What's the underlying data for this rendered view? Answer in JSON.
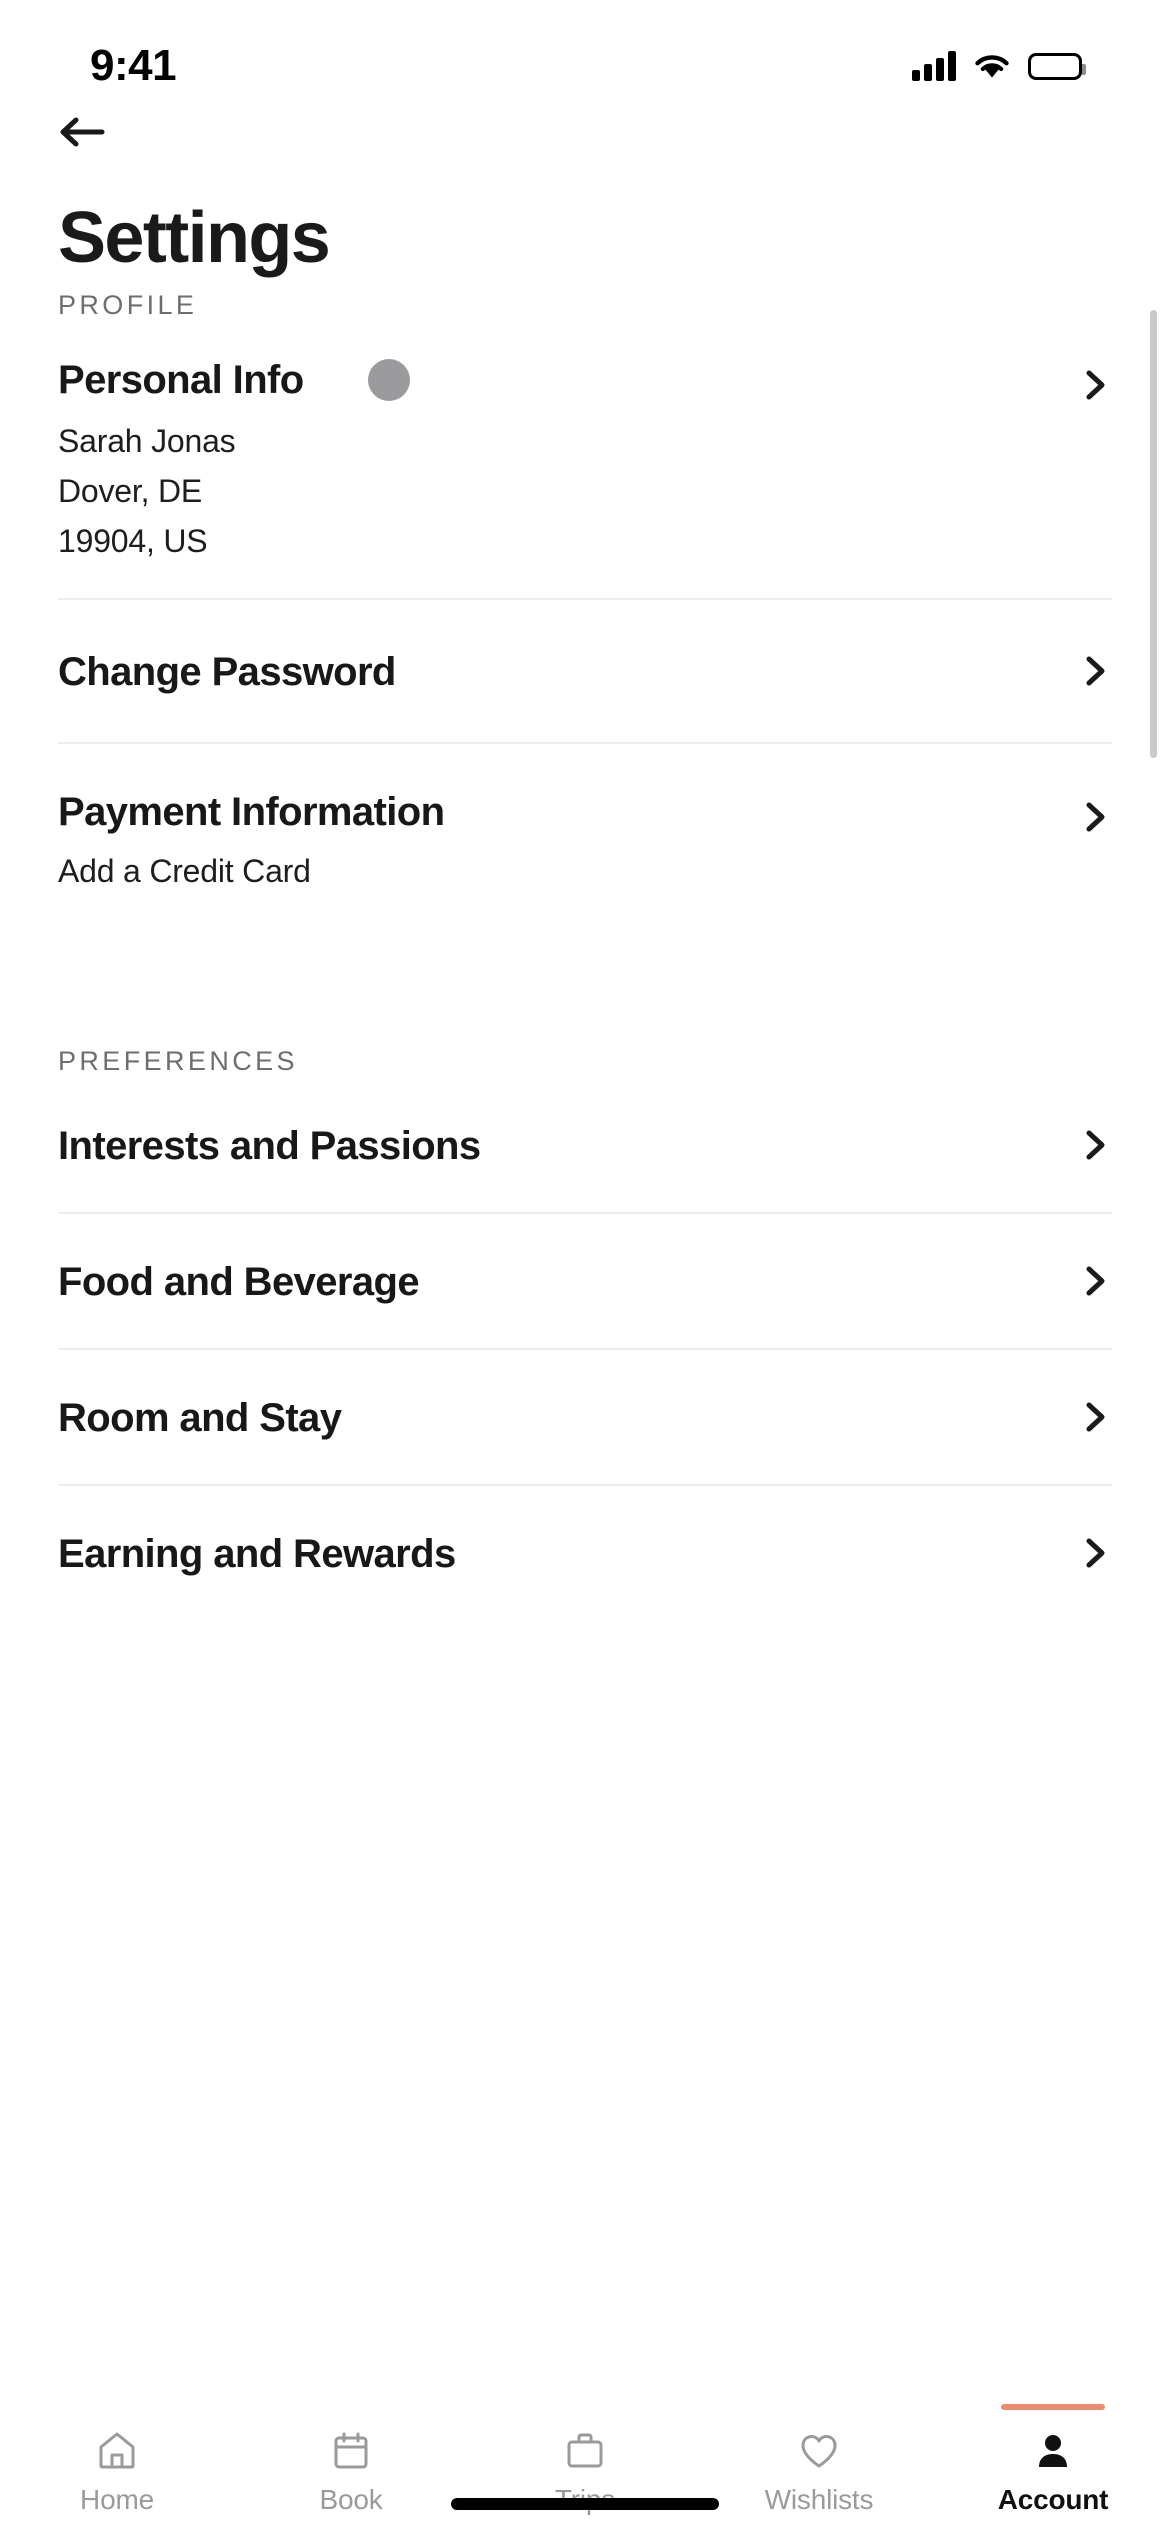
{
  "status_bar": {
    "time": "9:41",
    "cellular_icon": "cellular-signal-icon",
    "wifi_icon": "wifi-icon",
    "battery_icon": "battery-full-icon"
  },
  "nav": {
    "back_icon": "back-arrow-icon"
  },
  "header": {
    "title": "Settings"
  },
  "sections": [
    {
      "label": "PROFILE",
      "rows": [
        {
          "title": "Personal Info",
          "has_avatar": true,
          "sublines": [
            "Sarah Jonas",
            "Dover, DE",
            "19904, US"
          ],
          "chevron": "chevron-right-icon"
        },
        {
          "title": "Change Password",
          "has_avatar": false,
          "sublines": [],
          "chevron": "chevron-right-icon"
        },
        {
          "title": "Payment Information",
          "has_avatar": false,
          "sublines": [
            "Add a Credit Card"
          ],
          "chevron": "chevron-right-icon"
        }
      ]
    },
    {
      "label": "PREFERENCES",
      "rows": [
        {
          "title": "Interests and Passions",
          "has_avatar": false,
          "sublines": [],
          "chevron": "chevron-right-icon"
        },
        {
          "title": "Food and Beverage",
          "has_avatar": false,
          "sublines": [],
          "chevron": "chevron-right-icon"
        },
        {
          "title": "Room and Stay",
          "has_avatar": false,
          "sublines": [],
          "chevron": "chevron-right-icon"
        },
        {
          "title": "Earning and Rewards",
          "has_avatar": false,
          "sublines": [],
          "chevron": "chevron-right-icon"
        }
      ]
    }
  ],
  "tabbar": {
    "active_index": 4,
    "accent_color": "#f08a6c",
    "items": [
      {
        "label": "Home",
        "icon": "home-icon"
      },
      {
        "label": "Book",
        "icon": "calendar-icon"
      },
      {
        "label": "Trips",
        "icon": "briefcase-icon"
      },
      {
        "label": "Wishlists",
        "icon": "heart-icon"
      },
      {
        "label": "Account",
        "icon": "person-icon"
      }
    ]
  },
  "colors": {
    "text_primary": "#181818",
    "text_secondary": "#6e6e6e",
    "divider": "#ececec",
    "avatar_placeholder": "#9b9b9e"
  }
}
